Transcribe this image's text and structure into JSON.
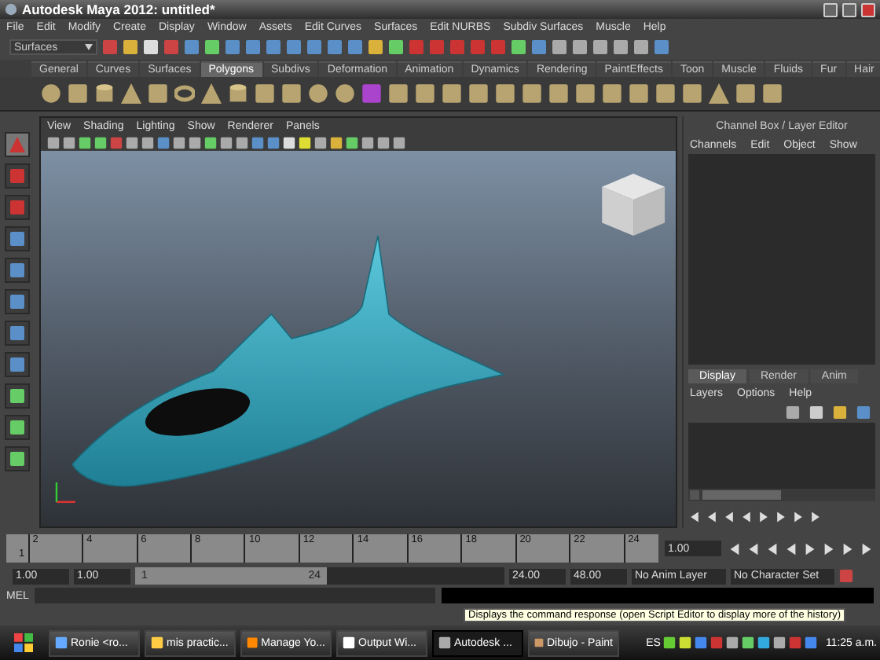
{
  "window": {
    "title": "Autodesk Maya 2012: untitled*"
  },
  "menu_bar": [
    "File",
    "Edit",
    "Modify",
    "Create",
    "Display",
    "Window",
    "Assets",
    "Edit Curves",
    "Surfaces",
    "Edit NURBS",
    "Subdiv Surfaces",
    "Muscle",
    "Help"
  ],
  "status_line": {
    "menu_set": "Surfaces"
  },
  "shelf": {
    "tabs": [
      {
        "label": "General",
        "selected": false
      },
      {
        "label": "Curves",
        "selected": false
      },
      {
        "label": "Surfaces",
        "selected": false
      },
      {
        "label": "Polygons",
        "selected": true
      },
      {
        "label": "Subdivs",
        "selected": false
      },
      {
        "label": "Deformation",
        "selected": false
      },
      {
        "label": "Animation",
        "selected": false
      },
      {
        "label": "Dynamics",
        "selected": false
      },
      {
        "label": "Rendering",
        "selected": false
      },
      {
        "label": "PaintEffects",
        "selected": false
      },
      {
        "label": "Toon",
        "selected": false
      },
      {
        "label": "Muscle",
        "selected": false
      },
      {
        "label": "Fluids",
        "selected": false
      },
      {
        "label": "Fur",
        "selected": false
      },
      {
        "label": "Hair",
        "selected": false
      }
    ]
  },
  "viewport": {
    "menu": [
      "View",
      "Shading",
      "Lighting",
      "Show",
      "Renderer",
      "Panels"
    ]
  },
  "channel_box": {
    "title": "Channel Box / Layer Editor",
    "menu": [
      "Channels",
      "Edit",
      "Object",
      "Show"
    ]
  },
  "layer_editor": {
    "tabs": [
      {
        "label": "Display",
        "selected": true
      },
      {
        "label": "Render",
        "selected": false
      },
      {
        "label": "Anim",
        "selected": false
      }
    ],
    "menu": [
      "Layers",
      "Options",
      "Help"
    ]
  },
  "time_slider": {
    "current_frame": "1",
    "ticks": [
      "2",
      "4",
      "6",
      "8",
      "10",
      "12",
      "14",
      "16",
      "18",
      "20",
      "22",
      "24"
    ],
    "current_time": "1.00"
  },
  "range_slider": {
    "start_time": "1.00",
    "playback_start": "1.00",
    "range_start": "1",
    "range_end": "24",
    "playback_end": "24.00",
    "end_time": "48.00",
    "anim_layer": "No Anim Layer",
    "character_set": "No Character Set"
  },
  "command_line": {
    "label": "MEL"
  },
  "help_line": {
    "tooltip": "Displays the command response (open Script Editor to display more of the history)"
  },
  "taskbar": {
    "items": [
      {
        "label": "Ronie <ro...",
        "selected": false
      },
      {
        "label": "mis practic...",
        "selected": false
      },
      {
        "label": "Manage Yo...",
        "selected": false
      },
      {
        "label": "Output Wi...",
        "selected": false
      },
      {
        "label": "Autodesk ...",
        "selected": true
      },
      {
        "label": "Dibujo - Paint",
        "selected": false
      }
    ],
    "language": "ES",
    "clock": "11:25 a.m."
  }
}
